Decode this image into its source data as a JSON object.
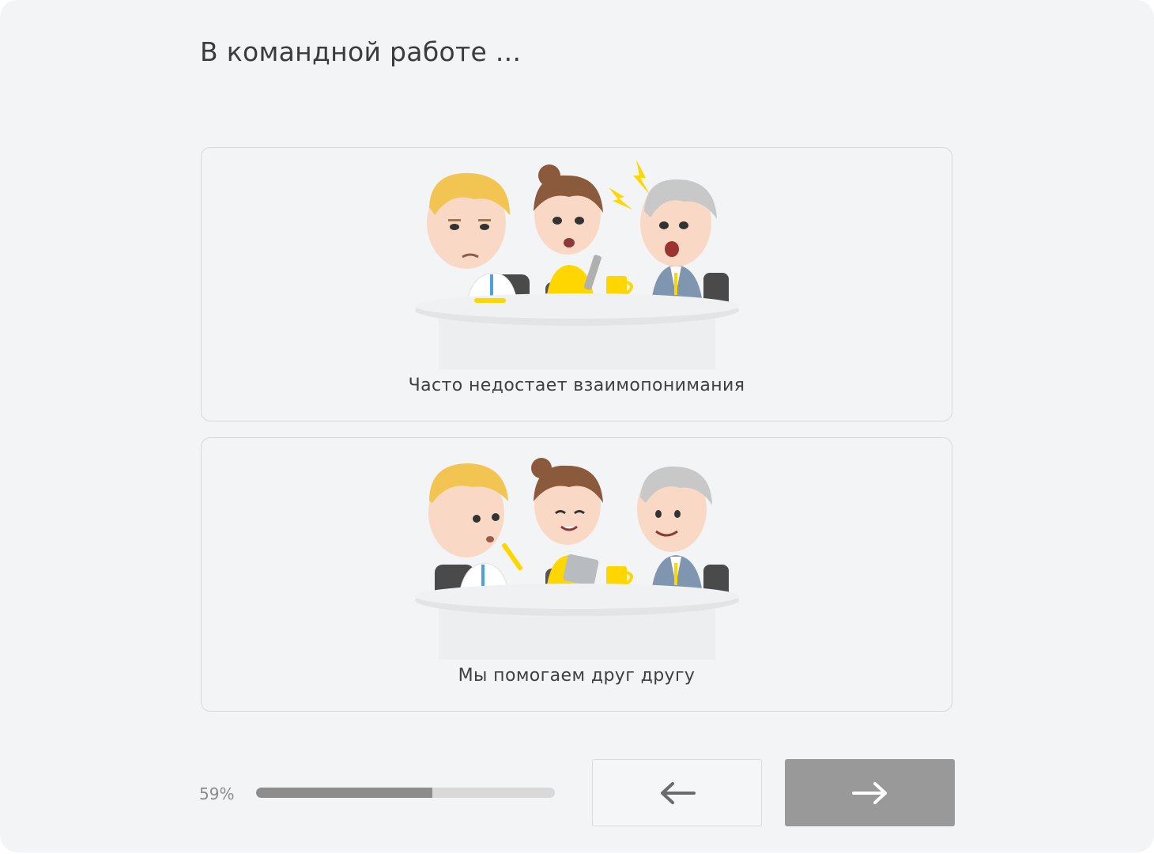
{
  "question": {
    "title": "В командной работе ..."
  },
  "options": [
    {
      "label": "Часто недостает взаимопонимания",
      "illustration": "team-conflict-illustration"
    },
    {
      "label": "Мы помогаем друг другу",
      "illustration": "team-cooperation-illustration"
    }
  ],
  "progress": {
    "label": "59%",
    "value": 0.59
  },
  "navigation": {
    "back_icon": "arrow-left-icon",
    "next_icon": "arrow-right-icon"
  },
  "colors": {
    "background": "#f3f4f6",
    "accent_yellow": "#ffd600",
    "progress_fill": "#8d8d8d",
    "next_button": "#999999"
  }
}
